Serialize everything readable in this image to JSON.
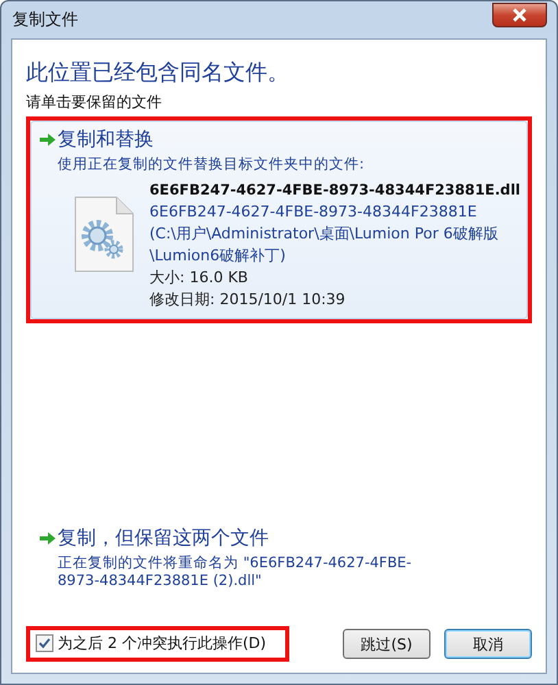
{
  "window": {
    "title": "复制文件"
  },
  "heading": "此位置已经包含同名文件。",
  "instruction": "请单击要保留的文件",
  "options": [
    {
      "kind": "replace",
      "hovered": true,
      "annotated": true,
      "title": "复制和替换",
      "description": "使用正在复制的文件替换目标文件夹中的文件:",
      "file": {
        "name": "6E6FB247-4627-4FBE-8973-48344F23881E.dll",
        "path": "6E6FB247-4627-4FBE-8973-48344F23881E (C:\\用户\\Administrator\\桌面\\Lumion Por 6破解版\\Lumion6破解补丁)",
        "size": "大小: 16.0 KB",
        "modified": "修改日期: 2015/10/1 10:39"
      }
    },
    {
      "kind": "keep_both",
      "hovered": false,
      "annotated": false,
      "title": "复制，但保留这两个文件",
      "description": "正在复制的文件将重命名为 \"6E6FB247-4627-4FBE-8973-48344F23881E (2).dll\""
    }
  ],
  "apply_all": {
    "label": "为之后 2 个冲突执行此操作(D)",
    "checked": true,
    "annotated": true
  },
  "buttons": [
    {
      "label": "跳过(S)",
      "default": false
    },
    {
      "label": "取消",
      "default": true
    }
  ]
}
